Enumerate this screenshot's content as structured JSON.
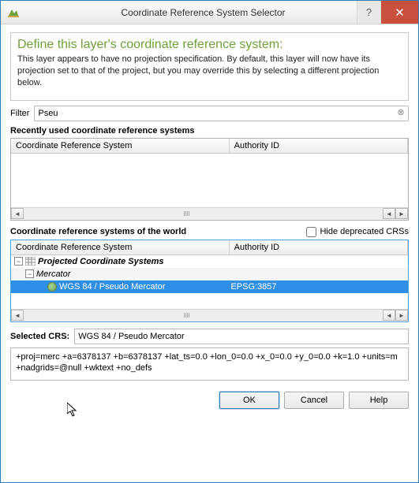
{
  "window": {
    "title": "Coordinate Reference System Selector"
  },
  "info": {
    "heading": "Define this layer's coordinate reference system:",
    "description": "This layer appears to have no projection specification. By default, this layer will now have its projection set to that of the project, but you may override this by selecting a different projection below."
  },
  "filter": {
    "label": "Filter",
    "value": "Pseu"
  },
  "recent": {
    "label": "Recently used coordinate reference systems",
    "headers": {
      "crs": "Coordinate Reference System",
      "auth": "Authority ID"
    }
  },
  "world": {
    "label": "Coordinate reference systems of the world",
    "hide_deprecated_label": "Hide deprecated CRSs",
    "hide_deprecated_checked": false,
    "headers": {
      "crs": "Coordinate Reference System",
      "auth": "Authority ID"
    },
    "tree": {
      "root": {
        "label": "Projected Coordinate Systems",
        "expanded": true
      },
      "child": {
        "label": "Mercator",
        "expanded": true
      },
      "selected": {
        "label": "WGS 84 / Pseudo Mercator",
        "auth": "EPSG:3857"
      }
    }
  },
  "selected_crs": {
    "label": "Selected CRS:",
    "value": "WGS 84 / Pseudo Mercator"
  },
  "proj_string": "+proj=merc +a=6378137 +b=6378137 +lat_ts=0.0 +lon_0=0.0 +x_0=0.0 +y_0=0.0 +k=1.0 +units=m +nadgrids=@null +wktext +no_defs",
  "buttons": {
    "ok": "OK",
    "cancel": "Cancel",
    "help": "Help"
  }
}
